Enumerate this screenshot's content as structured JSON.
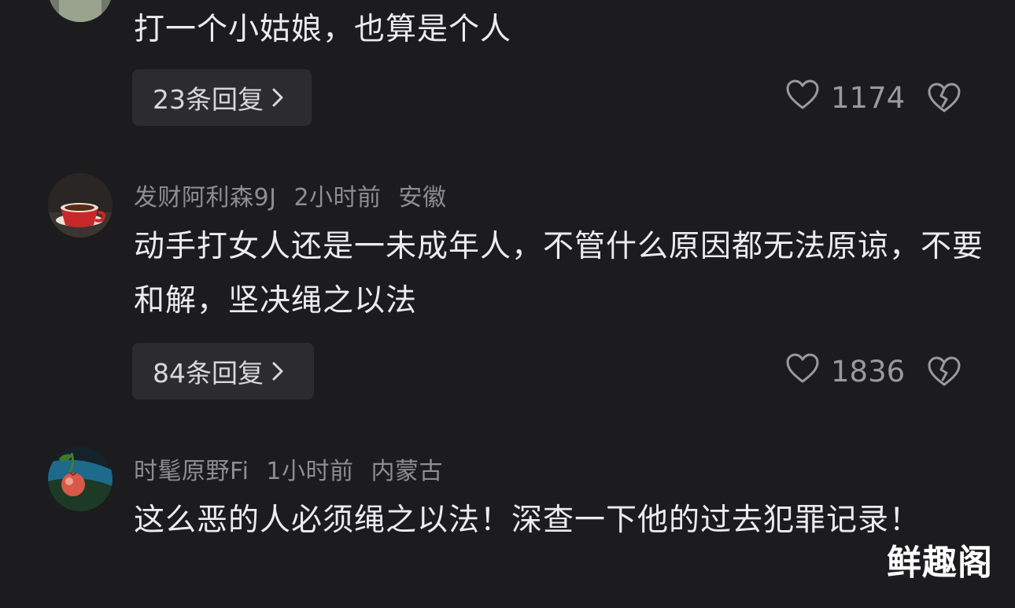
{
  "comments": [
    {
      "username": "",
      "time": "",
      "location": "",
      "text": "打一个小姑娘，也算是个人",
      "replies_label": "23条回复",
      "likes": "1174"
    },
    {
      "username": "发财阿利森9J",
      "time": "2小时前",
      "location": "安徽",
      "text": "动手打女人还是一未成年人，不管什么原因都无法原谅，不要和解，坚决绳之以法",
      "replies_label": "84条回复",
      "likes": "1836"
    },
    {
      "username": "时髦原野Fi",
      "time": "1小时前",
      "location": "内蒙古",
      "text": "这么恶的人必须绳之以法！深查一下他的过去犯罪记录！"
    }
  ],
  "watermark": "鲜趣阁",
  "colors": {
    "background": "#1c1c1e",
    "reply_button_bg": "#2c2c2e",
    "meta_text": "#8d8d92"
  },
  "icons": {
    "like": "heart-outline-icon",
    "dislike": "broken-heart-icon",
    "reply_chevron": "chevron-right-icon"
  }
}
